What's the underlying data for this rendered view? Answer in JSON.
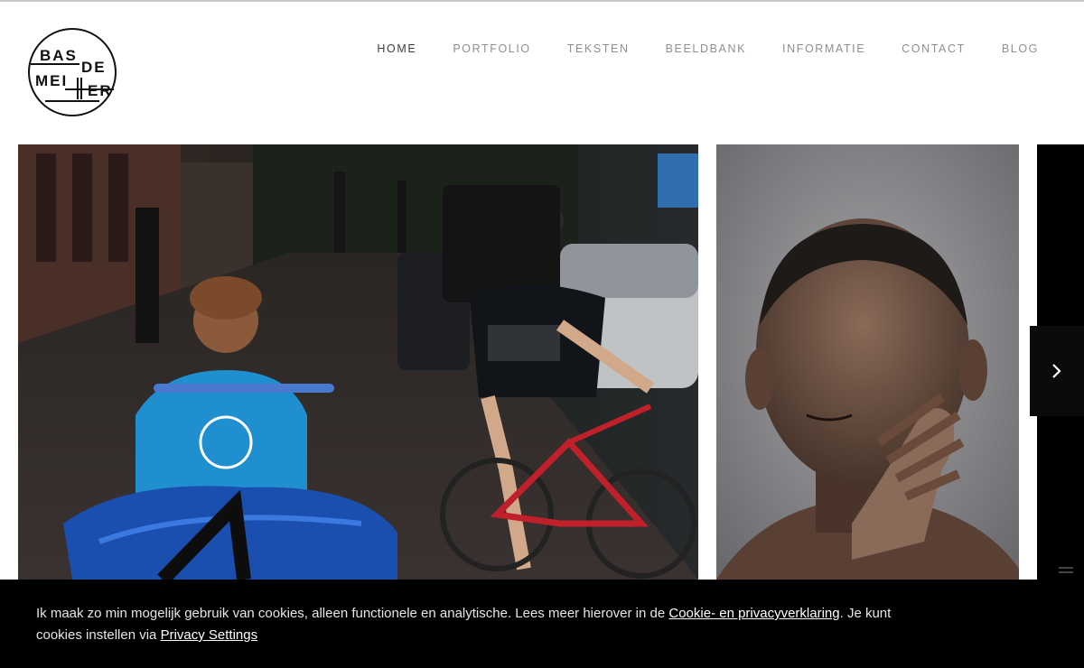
{
  "logo": {
    "line1": "BAS",
    "line2": "DE",
    "line3": "MEI",
    "line4": "ER"
  },
  "nav": {
    "items": [
      {
        "label": "HOME",
        "active": true
      },
      {
        "label": "PORTFOLIO",
        "active": false
      },
      {
        "label": "TEKSTEN",
        "active": false
      },
      {
        "label": "BEELDBANK",
        "active": false
      },
      {
        "label": "INFORMATIE",
        "active": false
      },
      {
        "label": "CONTACT",
        "active": false
      },
      {
        "label": "BLOG",
        "active": false
      }
    ]
  },
  "slider": {
    "next_icon": "chevron-right-icon"
  },
  "cookie": {
    "text_before": "Ik maak zo min mogelijk gebruik van cookies, alleen functionele en analytische. Lees meer hierover in de ",
    "policy_link": "Cookie- en privacyverklaring",
    "text_middle": ". Je kunt cookies instellen via ",
    "settings_link": "Privacy Settings"
  },
  "colors": {
    "nav_active": "#3e3e3e",
    "nav_inactive": "#8f8f8f",
    "cookie_bg": "#000000"
  }
}
